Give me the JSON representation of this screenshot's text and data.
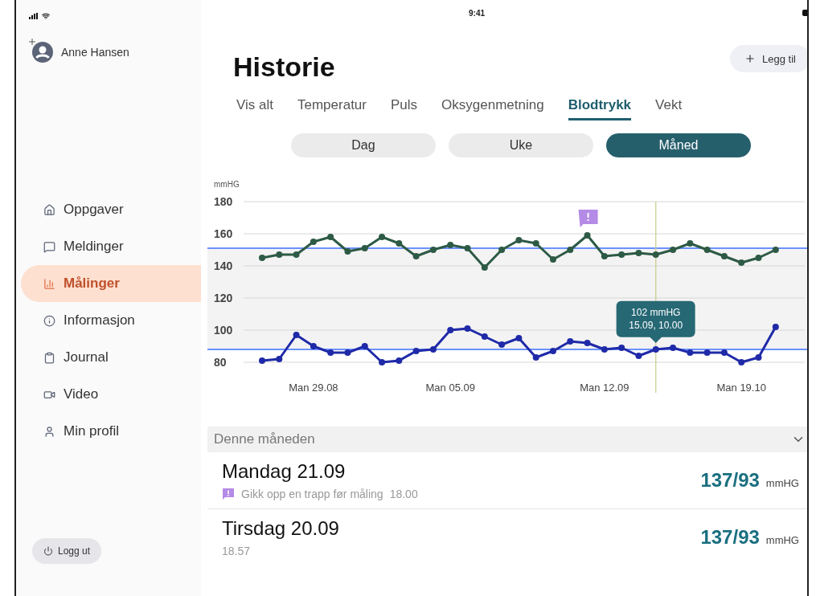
{
  "status_bar": {
    "time": "9:41"
  },
  "user": {
    "name": "Anne Hansen"
  },
  "sidebar": {
    "items": [
      {
        "label": "Oppgaver",
        "selected": false
      },
      {
        "label": "Meldinger",
        "selected": false
      },
      {
        "label": "Målinger",
        "selected": true
      },
      {
        "label": "Informasjon",
        "selected": false
      },
      {
        "label": "Journal",
        "selected": false
      },
      {
        "label": "Video",
        "selected": false
      },
      {
        "label": "Min profil",
        "selected": false
      }
    ],
    "logout": "Logg ut"
  },
  "page": {
    "title": "Historie",
    "add_button": "Legg til"
  },
  "tabs": [
    {
      "label": "Vis alt",
      "selected": false
    },
    {
      "label": "Temperatur",
      "selected": false
    },
    {
      "label": "Puls",
      "selected": false
    },
    {
      "label": "Oksygenmetning",
      "selected": false
    },
    {
      "label": "Blodtrykk",
      "selected": true
    },
    {
      "label": "Vekt",
      "selected": false
    }
  ],
  "periods": [
    {
      "label": "Dag",
      "selected": false
    },
    {
      "label": "Uke",
      "selected": false
    },
    {
      "label": "Måned",
      "selected": true
    }
  ],
  "chart_data": {
    "type": "line",
    "ylabel": "mmHG",
    "categories": [
      null,
      null,
      null,
      "Man 29.08",
      null,
      null,
      null,
      null,
      null,
      null,
      null,
      "Man 05.09",
      null,
      null,
      null,
      null,
      null,
      null,
      null,
      null,
      "Man 12.09",
      null,
      null,
      null,
      null,
      null,
      null,
      null,
      "Man 19.10",
      null,
      null
    ],
    "grid": true,
    "ylim": [
      80,
      180
    ],
    "yticks": [
      80,
      100,
      120,
      140,
      160,
      180
    ],
    "series": [
      {
        "color": "#2d5a45",
        "marker": "circle",
        "values": [
          145,
          147,
          147,
          155,
          158,
          149,
          151,
          158,
          154,
          146,
          150,
          153,
          151,
          139,
          150,
          156,
          154,
          144,
          150,
          159,
          146,
          147,
          148,
          147,
          150,
          154,
          150,
          146,
          142,
          145,
          150
        ]
      },
      {
        "color": "#1f2aa8",
        "marker": "circle",
        "values": [
          81,
          82,
          97,
          90,
          86,
          86,
          90,
          80,
          81,
          87,
          88,
          100,
          101,
          96,
          91,
          95,
          83,
          87,
          93,
          92,
          88,
          89,
          84,
          88,
          89,
          86,
          86,
          86,
          80,
          83,
          102
        ]
      }
    ],
    "ref_lines": [
      {
        "axis": "y",
        "value": 151
      },
      {
        "axis": "y",
        "value": 88
      }
    ],
    "annotations": [
      {
        "text": [
          "102 mmHG",
          "15.09, 10.00"
        ]
      }
    ]
  },
  "list": {
    "header": "Denne måneden",
    "expanded": true,
    "entries": [
      {
        "day": "Mandag 21.09",
        "note": "Gikk opp en trapp før måling",
        "time": "18.00",
        "value": "137/93",
        "unit": "mmHG"
      },
      {
        "day": "Tirsdag 20.09",
        "time": "18.57",
        "value": "137/93",
        "unit": "mmHG"
      }
    ]
  }
}
